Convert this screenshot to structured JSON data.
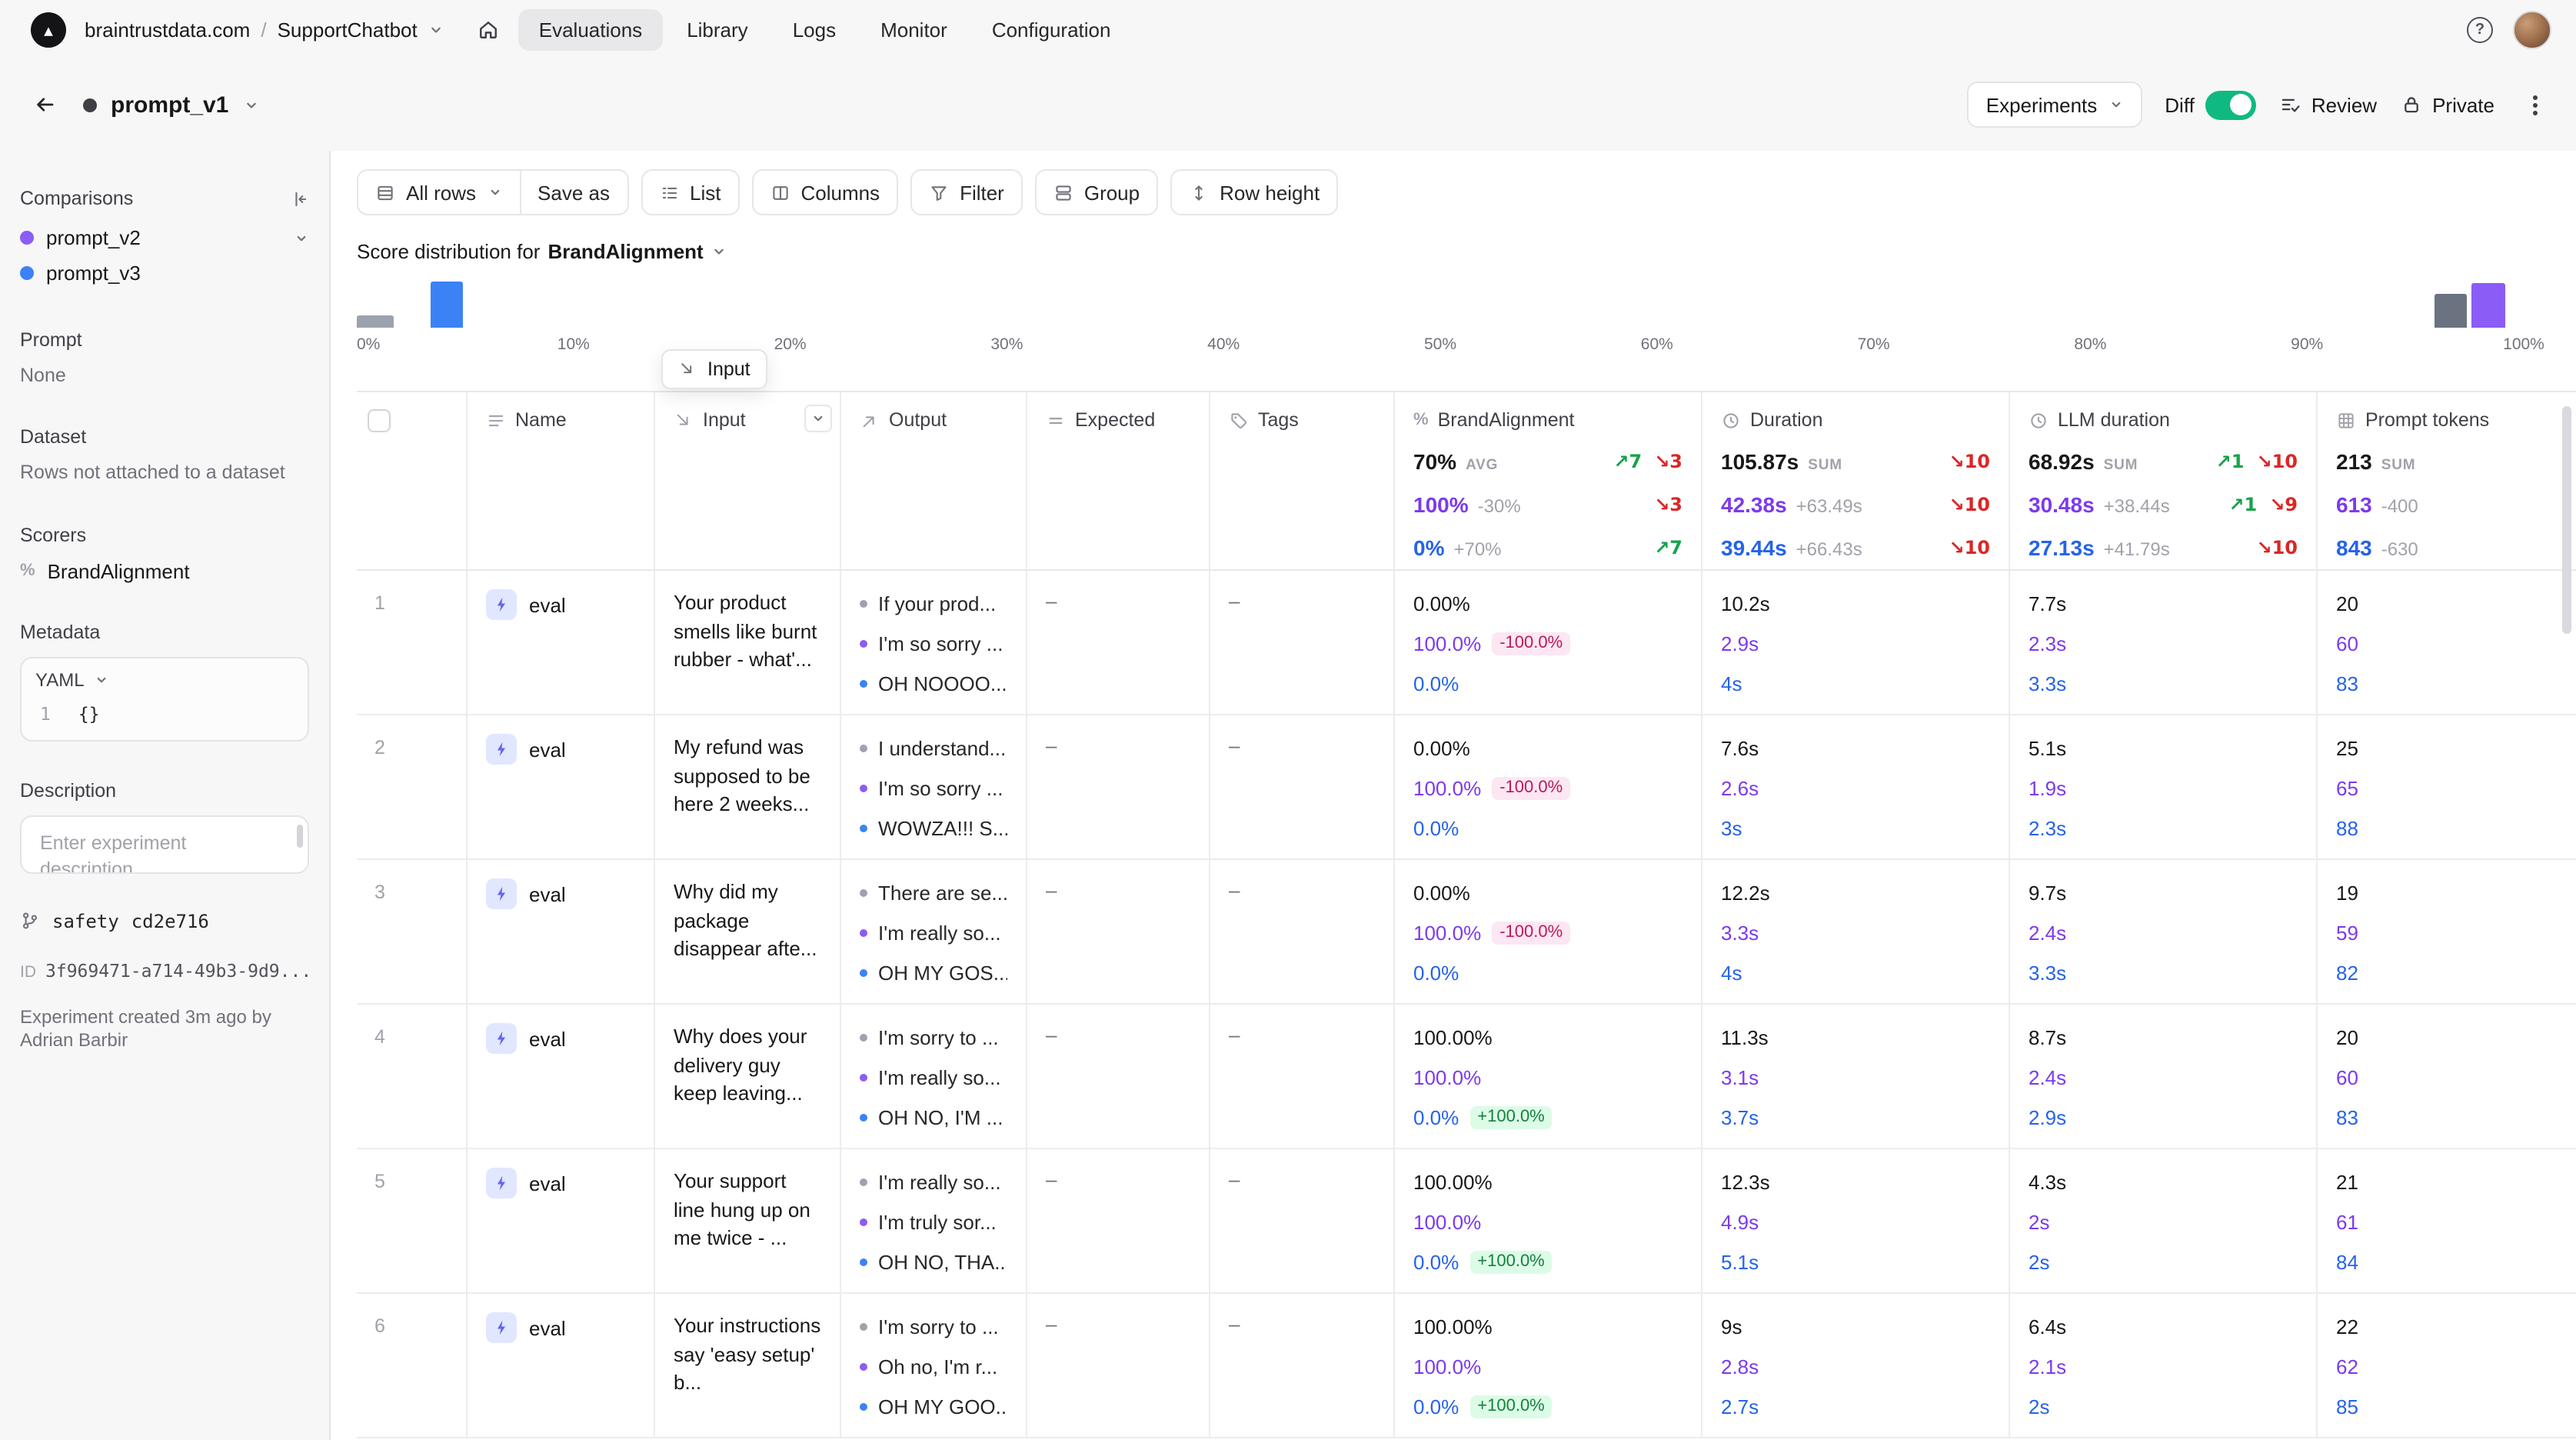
{
  "colors": {
    "accent_purple": "#7c3aed",
    "accent_blue": "#2563eb",
    "dot_gray": "#9ca3af",
    "improvement_green": "#16a34a",
    "regression_red": "#dc2626",
    "toggle_on_green": "#10b981"
  },
  "topnav": {
    "org": "braintrustdata.com",
    "separator": "/",
    "project": "SupportChatbot",
    "tabs": [
      {
        "label": "Evaluations",
        "active": true
      },
      {
        "label": "Library",
        "active": false
      },
      {
        "label": "Logs",
        "active": false
      },
      {
        "label": "Monitor",
        "active": false
      },
      {
        "label": "Configuration",
        "active": false
      }
    ]
  },
  "header": {
    "title": "prompt_v1",
    "experiments_button": "Experiments",
    "diff_label": "Diff",
    "diff_on": true,
    "review_button": "Review",
    "private_button": "Private"
  },
  "sidebar": {
    "comparisons_label": "Comparisons",
    "comparisons": [
      {
        "name": "prompt_v2",
        "color": "#8b5cf6",
        "has_menu": true
      },
      {
        "name": "prompt_v3",
        "color": "#3b82f6",
        "has_menu": false
      }
    ],
    "prompt_label": "Prompt",
    "prompt_value": "None",
    "dataset_label": "Dataset",
    "dataset_value": "Rows not attached to a dataset",
    "scorers_label": "Scorers",
    "scorer": "BrandAlignment",
    "metadata_label": "Metadata",
    "metadata_format": "YAML",
    "metadata_line": "1",
    "metadata_code": "{}",
    "description_label": "Description",
    "description_placeholder": "Enter experiment description...",
    "branch_name": "safety",
    "commit_hash": "cd2e716",
    "id_label": "ID",
    "id_value": "3f969471-a714-49b3-9d9...",
    "created_note": "Experiment created 3m ago by Adrian Barbir"
  },
  "toolbar": {
    "all_rows": "All rows",
    "save_as": "Save as",
    "list": "List",
    "columns": "Columns",
    "filter": "Filter",
    "group": "Group",
    "row_height": "Row height"
  },
  "distribution": {
    "title_prefix": "Score distribution for",
    "scorer": "BrandAlignment",
    "axis_labels": [
      "0%",
      "10%",
      "20%",
      "30%",
      "40%",
      "50%",
      "60%",
      "70%",
      "80%",
      "90%",
      "100%"
    ],
    "bars": [
      {
        "bucket": "0%",
        "series": "prompt_v1",
        "pos_pct": 0,
        "width": 24,
        "height": 8,
        "color": "#9ca3af"
      },
      {
        "bucket": "0-5%",
        "series": "prompt_v3",
        "pos_pct": 3.4,
        "width": 21,
        "height": 30,
        "color": "#3b82f6"
      },
      {
        "bucket": "95-100%",
        "series": "prompt_v1",
        "pos_pct": 95.9,
        "width": 21,
        "height": 22,
        "color": "#6b7280"
      },
      {
        "bucket": "100%",
        "series": "prompt_v2",
        "pos_pct": 97.6,
        "width": 22,
        "height": 29,
        "color": "#8b5cf6"
      }
    ]
  },
  "drag_tooltip": {
    "label": "Input"
  },
  "table": {
    "headers": {
      "name": "Name",
      "input": "Input",
      "output": "Output",
      "expected": "Expected",
      "tags": "Tags",
      "brand": "BrandAlignment",
      "duration": "Duration",
      "llm": "LLM duration",
      "tokens": "Prompt tokens"
    },
    "aggregates": {
      "brand": [
        {
          "value": "70%",
          "suffix": "AVG",
          "up": "7",
          "down": "3"
        },
        {
          "value": "100%",
          "delta": "-30%",
          "down": "3"
        },
        {
          "value": "0%",
          "delta": "+70%",
          "up": "7"
        }
      ],
      "duration": [
        {
          "value": "105.87s",
          "suffix": "SUM",
          "down": "10"
        },
        {
          "value": "42.38s",
          "delta": "+63.49s",
          "down": "10"
        },
        {
          "value": "39.44s",
          "delta": "+66.43s",
          "down": "10"
        }
      ],
      "llm": [
        {
          "value": "68.92s",
          "suffix": "SUM",
          "up": "1",
          "down": "10"
        },
        {
          "value": "30.48s",
          "delta": "+38.44s",
          "up": "1",
          "down": "9"
        },
        {
          "value": "27.13s",
          "delta": "+41.79s",
          "down": "10"
        }
      ],
      "tokens": [
        {
          "value": "213",
          "suffix": "SUM"
        },
        {
          "value": "613",
          "delta": "-400"
        },
        {
          "value": "843",
          "delta": "-630"
        }
      ]
    },
    "rows": [
      {
        "num": "1",
        "name": "eval",
        "input": "Your product smells like burnt rubber - what'...",
        "outputs": [
          "If your prod...",
          "I'm so sorry ...",
          "OH NOOOO..."
        ],
        "expected": "–",
        "tags": "–",
        "brand": [
          {
            "v": "0.00%"
          },
          {
            "v": "100.0%",
            "badge": "-100.0%"
          },
          {
            "v": "0.0%"
          }
        ],
        "duration": [
          "10.2s",
          "2.9s",
          "4s"
        ],
        "llm": [
          "7.7s",
          "2.3s",
          "3.3s"
        ],
        "tokens": [
          "20",
          "60",
          "83"
        ]
      },
      {
        "num": "2",
        "name": "eval",
        "input": "My refund was supposed to be here 2 weeks...",
        "outputs": [
          "I understand...",
          "I'm so sorry ...",
          "WOWZA!!! S..."
        ],
        "expected": "–",
        "tags": "–",
        "brand": [
          {
            "v": "0.00%"
          },
          {
            "v": "100.0%",
            "badge": "-100.0%"
          },
          {
            "v": "0.0%"
          }
        ],
        "duration": [
          "7.6s",
          "2.6s",
          "3s"
        ],
        "llm": [
          "5.1s",
          "1.9s",
          "2.3s"
        ],
        "tokens": [
          "25",
          "65",
          "88"
        ]
      },
      {
        "num": "3",
        "name": "eval",
        "input": "Why did my package disappear afte...",
        "outputs": [
          "There are se...",
          "I'm really so...",
          "OH MY GOS..."
        ],
        "expected": "–",
        "tags": "–",
        "brand": [
          {
            "v": "0.00%"
          },
          {
            "v": "100.0%",
            "badge": "-100.0%"
          },
          {
            "v": "0.0%"
          }
        ],
        "duration": [
          "12.2s",
          "3.3s",
          "4s"
        ],
        "llm": [
          "9.7s",
          "2.4s",
          "3.3s"
        ],
        "tokens": [
          "19",
          "59",
          "82"
        ]
      },
      {
        "num": "4",
        "name": "eval",
        "input": "Why does your delivery guy keep leaving...",
        "outputs": [
          "I'm sorry to ...",
          "I'm really so...",
          "OH NO, I'M ..."
        ],
        "expected": "–",
        "tags": "–",
        "brand": [
          {
            "v": "100.00%"
          },
          {
            "v": "100.0%"
          },
          {
            "v": "0.0%",
            "badge": "+100.0%"
          }
        ],
        "duration": [
          "11.3s",
          "3.1s",
          "3.7s"
        ],
        "llm": [
          "8.7s",
          "2.4s",
          "2.9s"
        ],
        "tokens": [
          "20",
          "60",
          "83"
        ]
      },
      {
        "num": "5",
        "name": "eval",
        "input": "Your support line hung up on me twice - ...",
        "outputs": [
          "I'm really so...",
          "I'm truly sor...",
          "OH NO, THA..."
        ],
        "expected": "–",
        "tags": "–",
        "brand": [
          {
            "v": "100.00%"
          },
          {
            "v": "100.0%"
          },
          {
            "v": "0.0%",
            "badge": "+100.0%"
          }
        ],
        "duration": [
          "12.3s",
          "4.9s",
          "5.1s"
        ],
        "llm": [
          "4.3s",
          "2s",
          "2s"
        ],
        "tokens": [
          "21",
          "61",
          "84"
        ]
      },
      {
        "num": "6",
        "name": "eval",
        "input": "Your instructions say 'easy setup' b...",
        "outputs": [
          "I'm sorry to ...",
          "Oh no, I'm r...",
          "OH MY GOO..."
        ],
        "expected": "–",
        "tags": "–",
        "brand": [
          {
            "v": "100.00%"
          },
          {
            "v": "100.0%"
          },
          {
            "v": "0.0%",
            "badge": "+100.0%"
          }
        ],
        "duration": [
          "9s",
          "2.8s",
          "2.7s"
        ],
        "llm": [
          "6.4s",
          "2.1s",
          "2s"
        ],
        "tokens": [
          "22",
          "62",
          "85"
        ]
      }
    ]
  }
}
